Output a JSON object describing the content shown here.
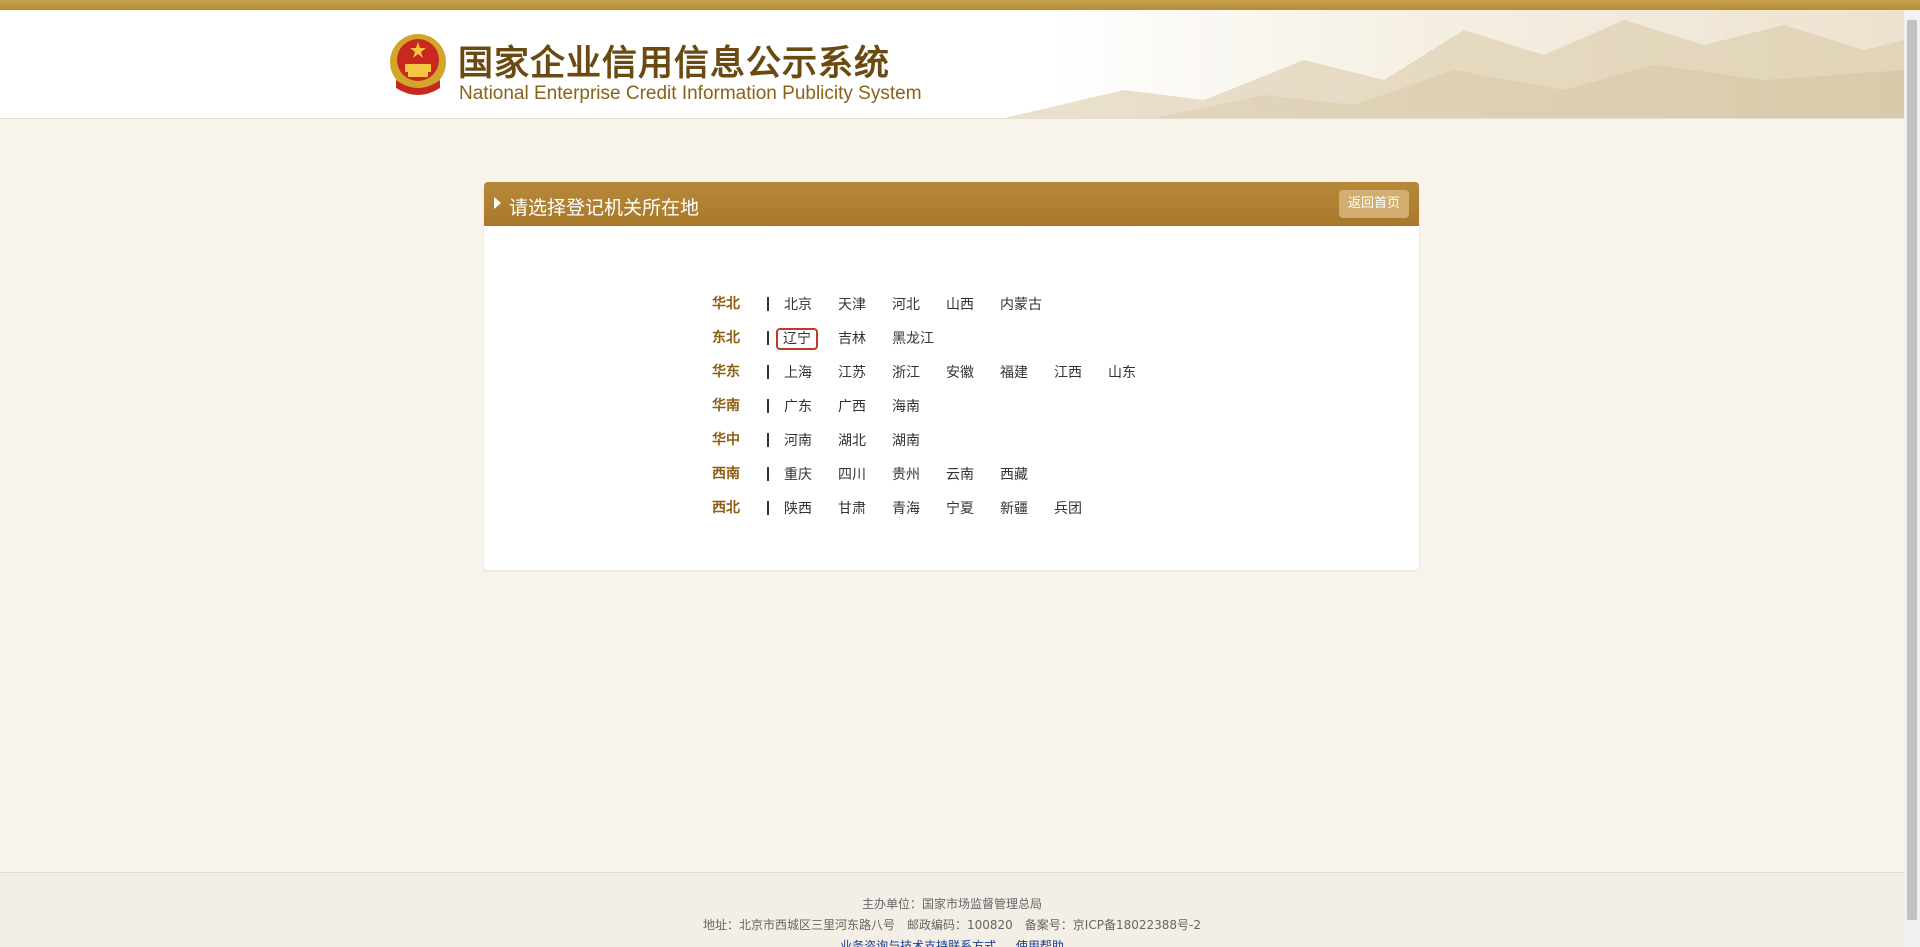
{
  "header": {
    "title_cn": "国家企业信用信息公示系统",
    "title_en": "National Enterprise Credit Information Publicity System"
  },
  "panel": {
    "title": "请选择登记机关所在地",
    "back_label": "返回首页"
  },
  "regions": [
    {
      "name": "华北",
      "provinces": [
        "北京",
        "天津",
        "河北",
        "山西",
        "内蒙古"
      ]
    },
    {
      "name": "东北",
      "provinces": [
        "辽宁",
        "吉林",
        "黑龙江"
      ]
    },
    {
      "name": "华东",
      "provinces": [
        "上海",
        "江苏",
        "浙江",
        "安徽",
        "福建",
        "江西",
        "山东"
      ]
    },
    {
      "name": "华南",
      "provinces": [
        "广东",
        "广西",
        "海南"
      ]
    },
    {
      "name": "华中",
      "provinces": [
        "河南",
        "湖北",
        "湖南"
      ]
    },
    {
      "name": "西南",
      "provinces": [
        "重庆",
        "四川",
        "贵州",
        "云南",
        "西藏"
      ]
    },
    {
      "name": "西北",
      "provinces": [
        "陕西",
        "甘肃",
        "青海",
        "宁夏",
        "新疆",
        "兵团"
      ]
    }
  ],
  "selected_province": "辽宁",
  "footer": {
    "line1": "主办单位：国家市场监督管理总局",
    "line2": "地址：北京市西城区三里河东路八号　邮政编码：100820　备案号：京ICP备18022388号-2",
    "link_contact": "业务咨询与技术支持联系方式",
    "link_help": "使用帮助"
  },
  "colors": {
    "accent": "#a9792a",
    "region_label": "#8a5e12",
    "selection_outline": "#c0392b"
  }
}
